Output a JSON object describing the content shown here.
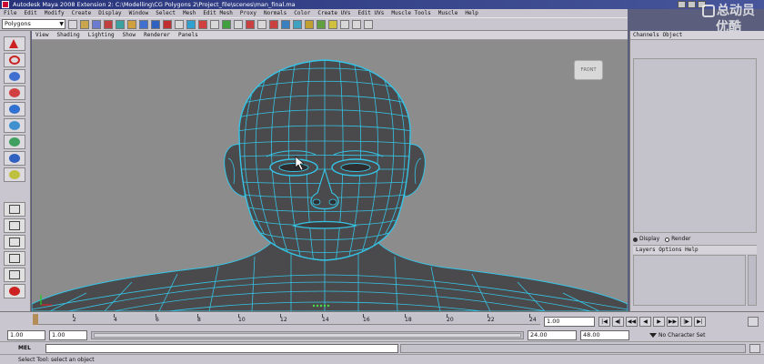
{
  "window": {
    "title": "Autodesk Maya 2008 Extension 2: C:\\Modelling\\CG Polygons 2\\Project_file\\scenes\\man_final.ma"
  },
  "watermark": {
    "line1": "总动员",
    "line2": "优酷"
  },
  "menubar": {
    "items": [
      "File",
      "Edit",
      "Modify",
      "Create",
      "Display",
      "Window",
      "Select",
      "Mesh",
      "Edit Mesh",
      "Proxy",
      "Normals",
      "Color",
      "Create UVs",
      "Edit UVs",
      "Muscle Tools",
      "Muscle",
      "Help"
    ]
  },
  "statusline": {
    "mode_value": "Polygons"
  },
  "panel_menu": {
    "items": [
      "View",
      "Shading",
      "Lighting",
      "Show",
      "Renderer",
      "Panels"
    ]
  },
  "viewport": {
    "viewcube_label": "FRONT"
  },
  "channel_box": {
    "header": "Channels  Object",
    "display_tab": "Display",
    "render_tab": "Render",
    "layer_menu": "Layers  Options  Help"
  },
  "time_slider": {
    "ticks": [
      "2",
      "4",
      "6",
      "8",
      "10",
      "12",
      "14",
      "16",
      "18",
      "20",
      "22",
      "24"
    ],
    "current_frame": "1.00"
  },
  "range_slider": {
    "start_value": "1.00",
    "playback_start": "1.00",
    "playback_end": "24.00",
    "end_value": "48.00",
    "character_set": "No Character Set"
  },
  "command_line": {
    "label": "MEL"
  },
  "help_line": {
    "text": "Select Tool: select an object"
  },
  "colors": {
    "wire": "#35c4e6",
    "mesh": "#4a4a4c",
    "viewport_bg": "#8c8c8c",
    "ui_bg": "#c9c6cf"
  }
}
